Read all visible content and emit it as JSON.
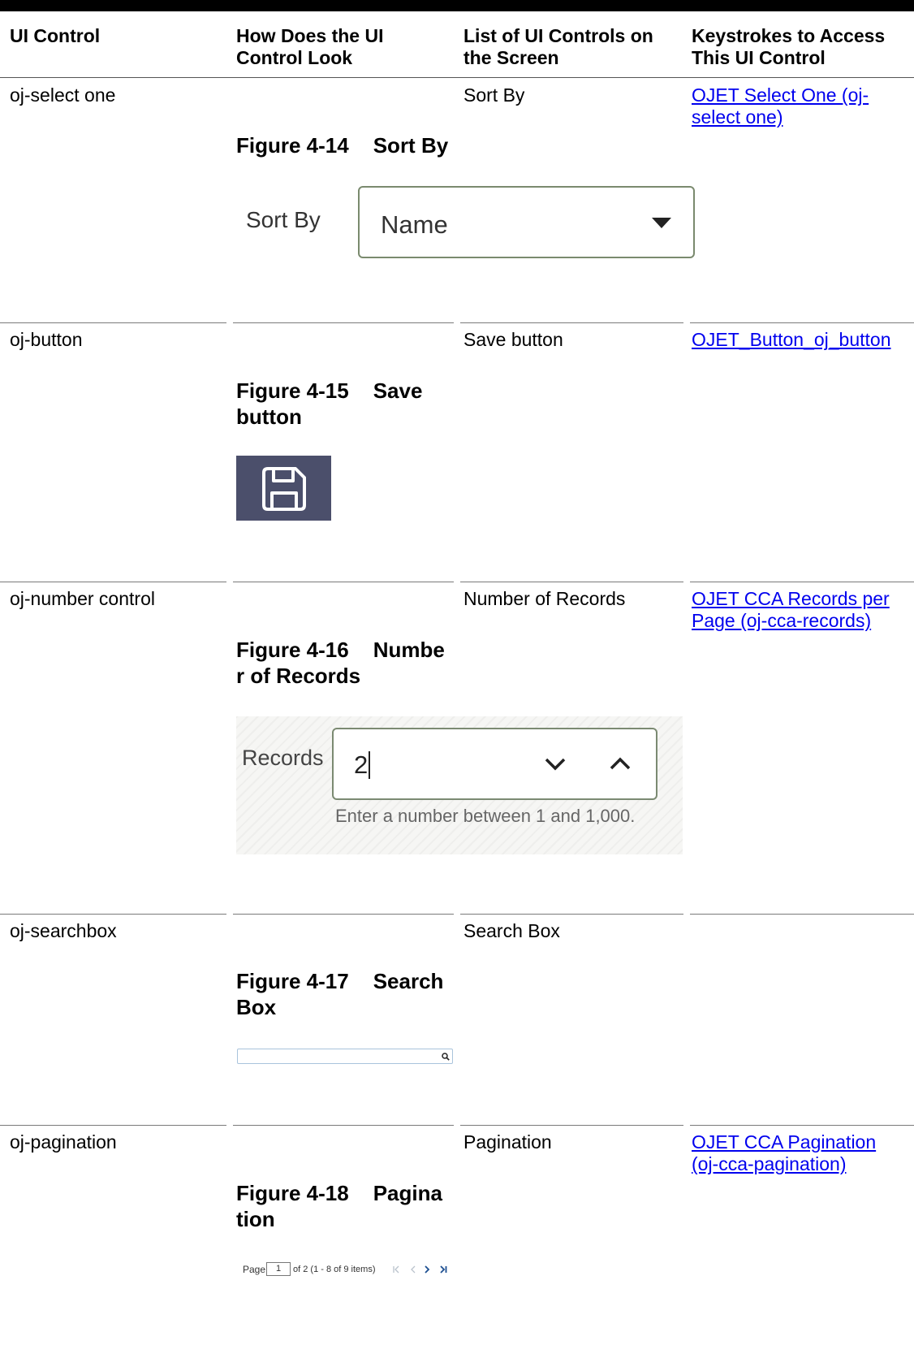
{
  "table": {
    "headers": [
      "UI Control",
      "How Does the UI Control Look",
      "List of UI Controls on the Screen",
      "Keystrokes to Access This UI Control"
    ],
    "rows": [
      {
        "control": "oj-select one",
        "figure_number": "Figure 4-14",
        "figure_title": "Sort By",
        "list": "Sort By",
        "keystroke_link": "OJET Select One (oj-select one)"
      },
      {
        "control": "oj-button",
        "figure_number": "Figure 4-15",
        "figure_title": "Save button",
        "list": "Save button",
        "keystroke_link": "OJET_Button_oj_button"
      },
      {
        "control": "oj-number control",
        "figure_number": "Figure 4-16",
        "figure_title": "Number of Records",
        "list": "Number of Records",
        "keystroke_link": "OJET CCA Records per Page (oj-cca-records)"
      },
      {
        "control": "oj-searchbox",
        "figure_number": "Figure 4-17",
        "figure_title": "Search Box",
        "list": "Search Box",
        "keystroke_link": ""
      },
      {
        "control": "oj-pagination",
        "figure_number": "Figure 4-18",
        "figure_title": "Pagination",
        "list": "Pagination",
        "keystroke_link": "OJET CCA Pagination (oj-cca-pagination)"
      }
    ]
  },
  "figures": {
    "sort_by": {
      "label": "Sort By",
      "value": "Name",
      "icon": "caret-down-icon"
    },
    "save_button": {
      "icon": "floppy-disk-icon",
      "color": "#4b4f6b"
    },
    "records": {
      "label": "Records",
      "value": "2",
      "help": "Enter a number between 1 and 1,000.",
      "icons": [
        "chevron-down-icon",
        "chevron-up-icon"
      ]
    },
    "search_box": {
      "icon": "search-icon"
    },
    "pagination": {
      "page_label": "Page",
      "page_value": "1",
      "summary": "of 2 (1 - 8 of 9 items)",
      "icons": [
        "first-page-icon",
        "previous-page-icon",
        "next-page-icon",
        "last-page-icon"
      ]
    }
  },
  "colors": {
    "link": "#0000ee",
    "save_button": "#4b4f6b",
    "search_border": "#a9c4dc"
  }
}
